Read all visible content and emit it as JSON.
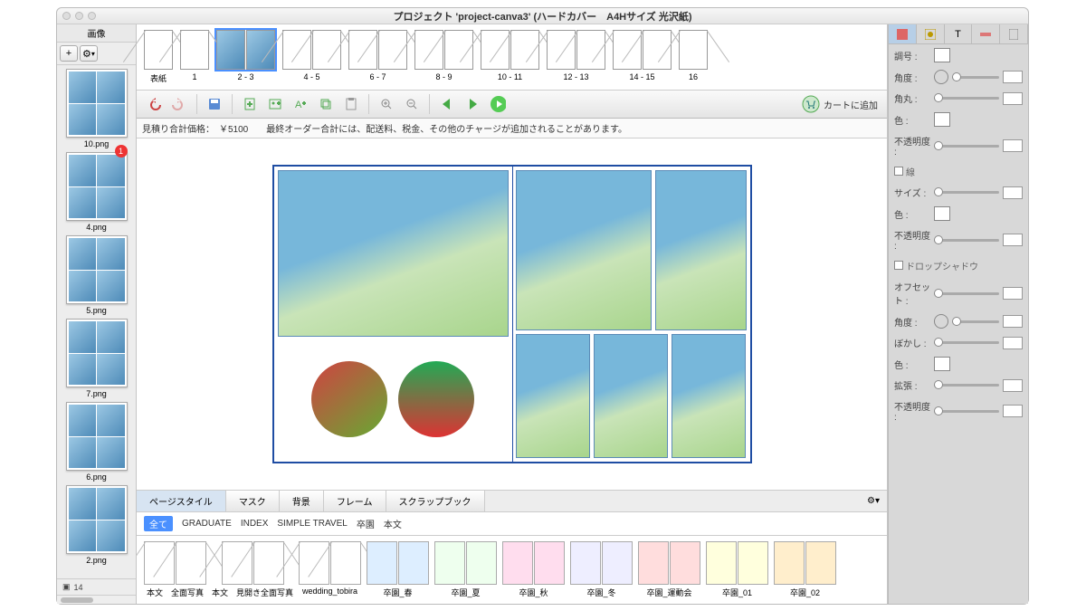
{
  "title": "プロジェクト 'project-canva3' (ハードカバー　A4Hサイズ 光沢紙)",
  "leftpanel": {
    "header": "画像",
    "add": "+",
    "gear": "⚙",
    "thumbs": [
      {
        "label": "10.png",
        "badge": ""
      },
      {
        "label": "4.png",
        "badge": "1"
      },
      {
        "label": "5.png",
        "badge": ""
      },
      {
        "label": "7.png",
        "badge": ""
      },
      {
        "label": "6.png",
        "badge": ""
      },
      {
        "label": "2.png",
        "badge": ""
      }
    ],
    "count": "14"
  },
  "pages": [
    {
      "label": "表紙",
      "double": false
    },
    {
      "label": "1",
      "double": false
    },
    {
      "label": "2 - 3",
      "double": true,
      "selected": true,
      "filled": true
    },
    {
      "label": "4 - 5",
      "double": true
    },
    {
      "label": "6 - 7",
      "double": true
    },
    {
      "label": "8 - 9",
      "double": true
    },
    {
      "label": "10 - 11",
      "double": true
    },
    {
      "label": "12 - 13",
      "double": true
    },
    {
      "label": "14 - 15",
      "double": true
    },
    {
      "label": "16",
      "double": false
    }
  ],
  "cart": "カートに追加",
  "info": "見積り合計価格：　￥5100　　最終オーダー合計には、配送料、税金、その他のチャージが追加されることがあります。",
  "tabs": {
    "items": [
      "ページスタイル",
      "マスク",
      "背景",
      "フレーム",
      "スクラップブック"
    ],
    "active": 0
  },
  "filters": {
    "all": "全て",
    "items": [
      "GRADUATE",
      "INDEX",
      "SIMPLE TRAVEL",
      "卒園",
      "本文"
    ]
  },
  "styles": [
    {
      "label": "本文　全面写真"
    },
    {
      "label": "本文　見開き全面写真"
    },
    {
      "label": "wedding_tobira"
    },
    {
      "label": "卒園_春"
    },
    {
      "label": "卒園_夏"
    },
    {
      "label": "卒園_秋"
    },
    {
      "label": "卒園_冬"
    },
    {
      "label": "卒園_運動会"
    },
    {
      "label": "卒園_01"
    },
    {
      "label": "卒園_02"
    }
  ],
  "rprops": {
    "p1": "調号 :",
    "p2": "角度 :",
    "p3": "角丸 :",
    "p4": "色 :",
    "p5": "不透明度 :",
    "sect1": "",
    "p6": "サイズ :",
    "p7": "色 :",
    "p8": "不透明度 :",
    "sect2": "ドロップシャドウ",
    "p9": "オフセット :",
    "p10": "角度 :",
    "p11": "ぼかし :",
    "p12": "色 :",
    "p13": "拡張 :",
    "p14": "不透明度 :"
  }
}
